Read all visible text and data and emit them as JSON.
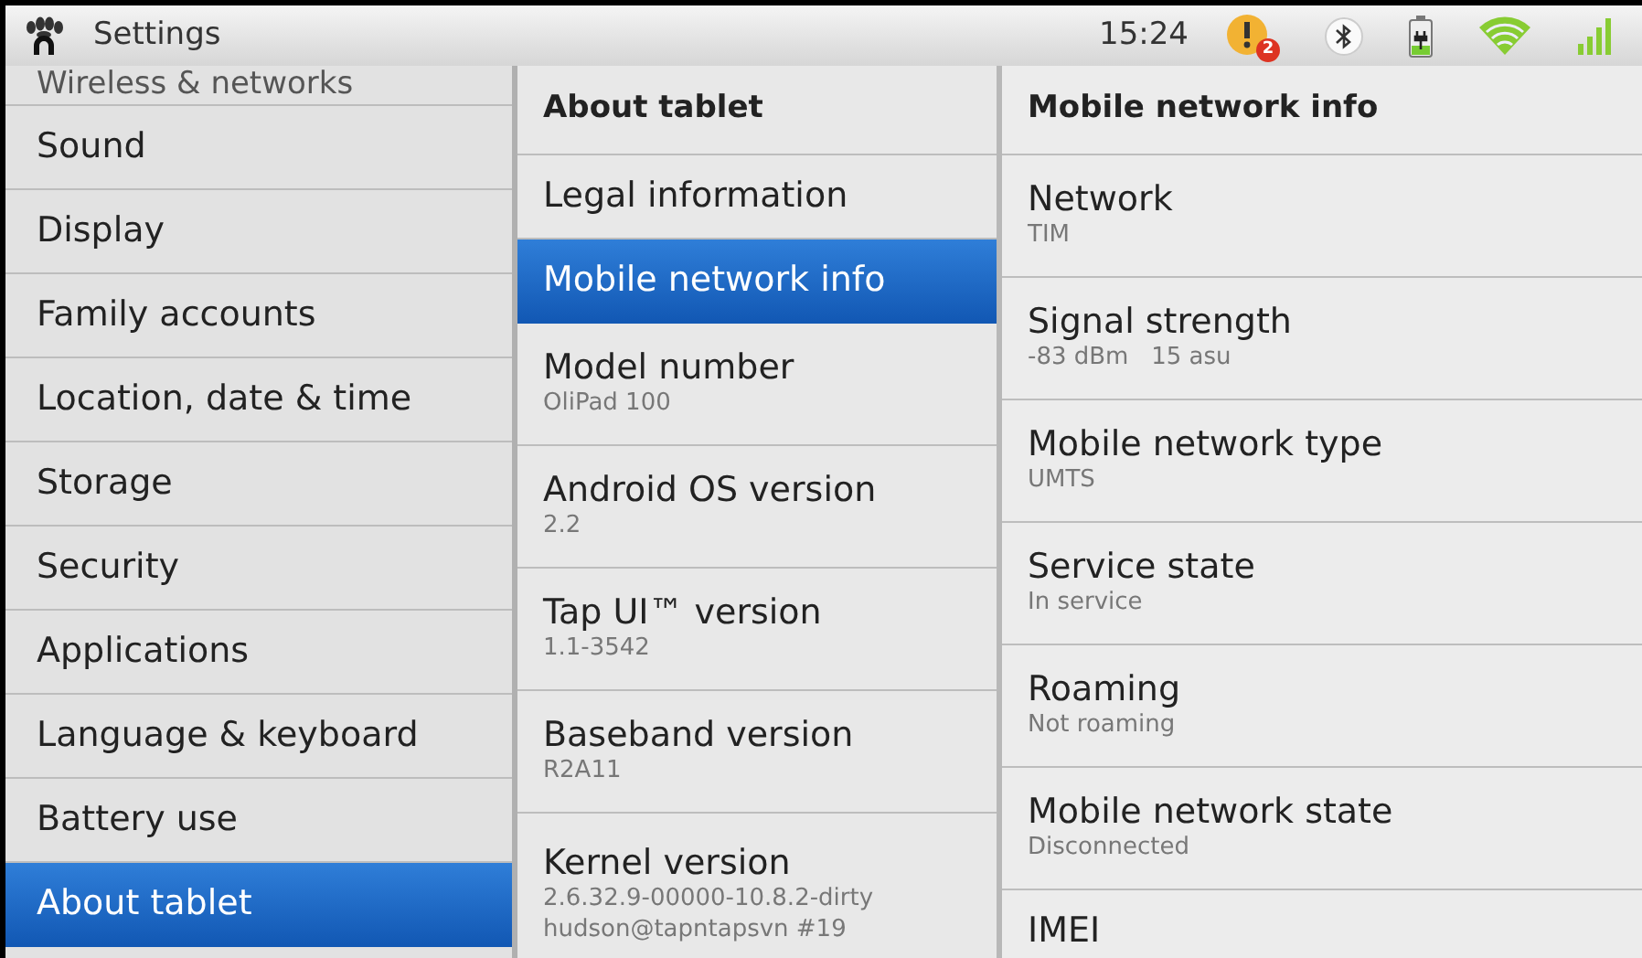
{
  "status_bar": {
    "app_title": "Settings",
    "time": "15:24",
    "notification_count": "2"
  },
  "categories": [
    {
      "label": "Wireless & networks",
      "selected": false
    },
    {
      "label": "Sound",
      "selected": false
    },
    {
      "label": "Display",
      "selected": false
    },
    {
      "label": "Family accounts",
      "selected": false
    },
    {
      "label": "Location, date & time",
      "selected": false
    },
    {
      "label": "Storage",
      "selected": false
    },
    {
      "label": "Security",
      "selected": false
    },
    {
      "label": "Applications",
      "selected": false
    },
    {
      "label": "Language & keyboard",
      "selected": false
    },
    {
      "label": "Battery use",
      "selected": false
    },
    {
      "label": "About tablet",
      "selected": true
    }
  ],
  "about": {
    "header": "About tablet",
    "items": [
      {
        "title": "Legal information",
        "selected": false
      },
      {
        "title": "Mobile network info",
        "selected": true
      },
      {
        "title": "Model number",
        "summary": [
          "OliPad 100"
        ],
        "selected": false
      },
      {
        "title": "Android OS version",
        "summary": [
          "2.2"
        ],
        "selected": false
      },
      {
        "title": "Tap UI™ version",
        "summary": [
          "1.1-3542"
        ],
        "selected": false
      },
      {
        "title": "Baseband version",
        "summary": [
          "R2A11"
        ],
        "selected": false
      },
      {
        "title": "Kernel version",
        "summary": [
          "2.6.32.9-00000-10.8.2-dirty",
          "hudson@tapntapsvn #19"
        ],
        "selected": false
      }
    ]
  },
  "network_info": {
    "header": "Mobile network info",
    "items": [
      {
        "title": "Network",
        "summary": "TIM"
      },
      {
        "title": "Signal strength",
        "summary": "-83 dBm   15 asu"
      },
      {
        "title": "Mobile network type",
        "summary": "UMTS"
      },
      {
        "title": "Service state",
        "summary": "In service"
      },
      {
        "title": "Roaming",
        "summary": "Not roaming"
      },
      {
        "title": "Mobile network state",
        "summary": "Disconnected"
      },
      {
        "title": "IMEI"
      }
    ]
  }
}
